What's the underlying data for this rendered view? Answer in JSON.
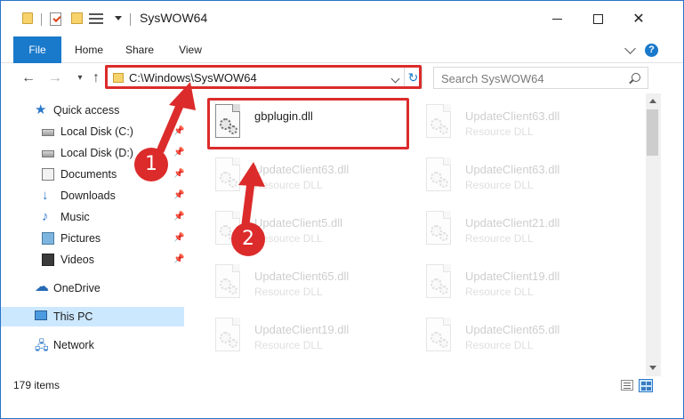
{
  "window": {
    "title": "SysWOW64"
  },
  "ribbon": {
    "tabs": [
      {
        "label": "File"
      },
      {
        "label": "Home"
      },
      {
        "label": "Share"
      },
      {
        "label": "View"
      }
    ]
  },
  "navbar": {
    "address": "C:\\Windows\\SysWOW64",
    "search_placeholder": "Search SysWOW64"
  },
  "sidebar": {
    "items": [
      {
        "label": "Quick access"
      },
      {
        "label": "Local Disk (C:)"
      },
      {
        "label": "Local Disk (D:)"
      },
      {
        "label": "Documents"
      },
      {
        "label": "Downloads"
      },
      {
        "label": "Music"
      },
      {
        "label": "Pictures"
      },
      {
        "label": "Videos"
      },
      {
        "label": "OneDrive"
      },
      {
        "label": "This PC"
      },
      {
        "label": "Network"
      }
    ]
  },
  "files": [
    {
      "name": "gbplugin.dll",
      "type": ""
    },
    {
      "name": "UpdateClient63.dll",
      "type": "Resource DLL"
    },
    {
      "name": "UpdateClient63.dll",
      "type": "Resource DLL"
    },
    {
      "name": "UpdateClient63.dll",
      "type": "Resource DLL"
    },
    {
      "name": "UpdateClient5.dll",
      "type": "Resource DLL"
    },
    {
      "name": "UpdateClient21.dll",
      "type": "Resource DLL"
    },
    {
      "name": "UpdateClient65.dll",
      "type": "Resource DLL"
    },
    {
      "name": "UpdateClient19.dll",
      "type": "Resource DLL"
    },
    {
      "name": "UpdateClient19.dll",
      "type": "Resource DLL"
    },
    {
      "name": "UpdateClient65.dll",
      "type": "Resource DLL"
    }
  ],
  "status": {
    "item_count": "179 items"
  },
  "annotations": {
    "step1": "1",
    "step2": "2",
    "color": "#dc2b2b"
  },
  "colors": {
    "accent": "#1979ca",
    "selection": "#cce8ff"
  }
}
